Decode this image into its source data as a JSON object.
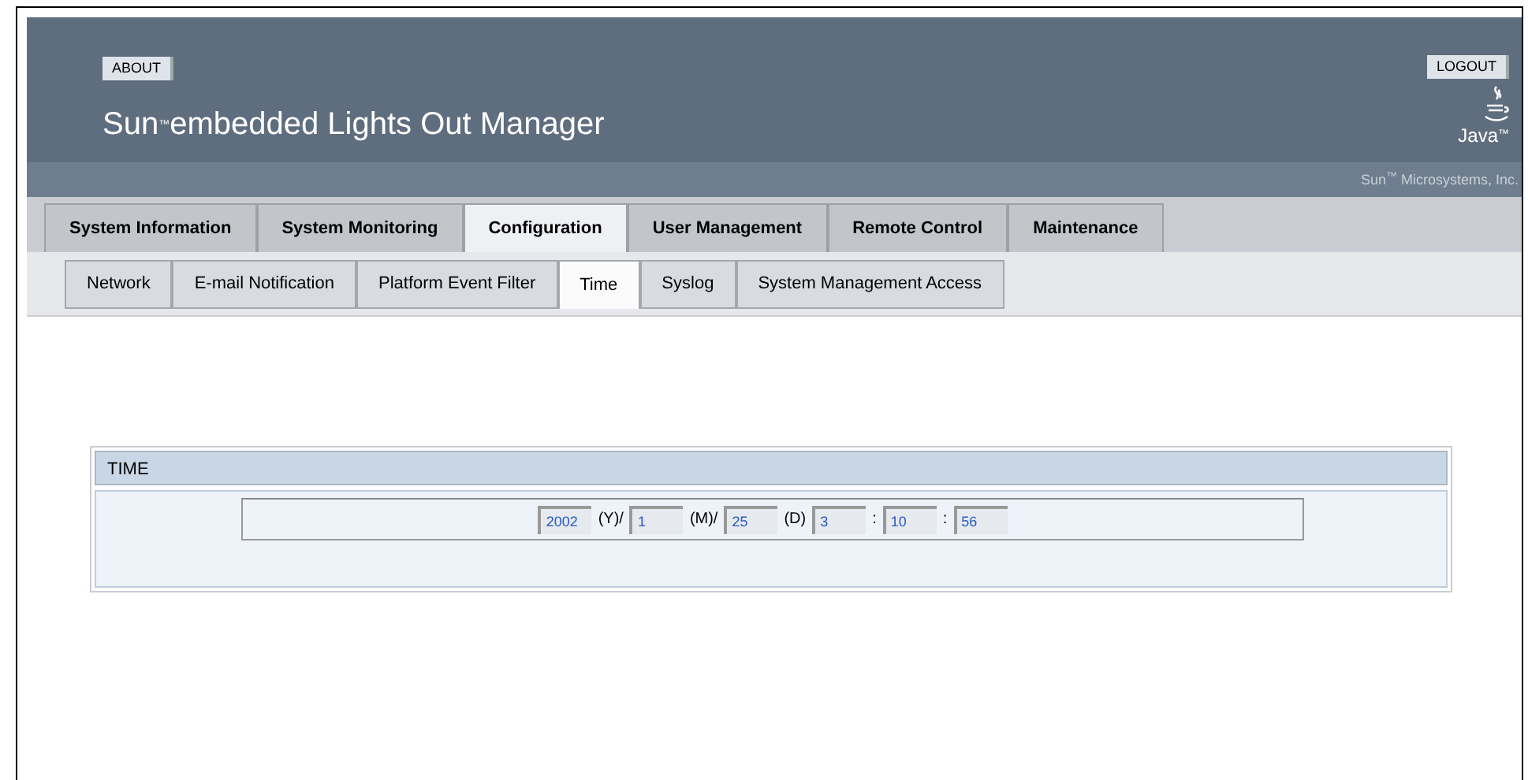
{
  "header": {
    "about_button": "ABOUT",
    "logout_button": "LOGOUT",
    "title": "Sun$^{™}$embedded Lights Out Manager",
    "java_logo_text": "Java$^{™}$",
    "company": "Sun$^{™}$ Microsystems, Inc."
  },
  "main_tabs": [
    {
      "label": "System Information",
      "selected": false
    },
    {
      "label": "System Monitoring",
      "selected": false
    },
    {
      "label": "Configuration",
      "selected": true
    },
    {
      "label": "User Management",
      "selected": false
    },
    {
      "label": "Remote Control",
      "selected": false
    },
    {
      "label": "Maintenance",
      "selected": false
    }
  ],
  "sub_tabs": [
    {
      "label": "Network",
      "selected": false
    },
    {
      "label": "E-mail Notification",
      "selected": false
    },
    {
      "label": "Platform Event Filter",
      "selected": false
    },
    {
      "label": "Time",
      "selected": true
    },
    {
      "label": "Syslog",
      "selected": false
    },
    {
      "label": "System Management Access",
      "selected": false
    }
  ],
  "time_panel": {
    "title": "TIME",
    "parts": [
      {
        "kind": "field",
        "value": "2002"
      },
      {
        "kind": "label",
        "text": "(Y)/"
      },
      {
        "kind": "field",
        "value": "1"
      },
      {
        "kind": "label",
        "text": "(M)/"
      },
      {
        "kind": "field",
        "value": "25"
      },
      {
        "kind": "label",
        "text": "(D)"
      },
      {
        "kind": "field",
        "value": "3"
      },
      {
        "kind": "label",
        "text": ":"
      },
      {
        "kind": "field",
        "value": "10"
      },
      {
        "kind": "label",
        "text": ":"
      },
      {
        "kind": "field",
        "value": "56"
      }
    ]
  }
}
